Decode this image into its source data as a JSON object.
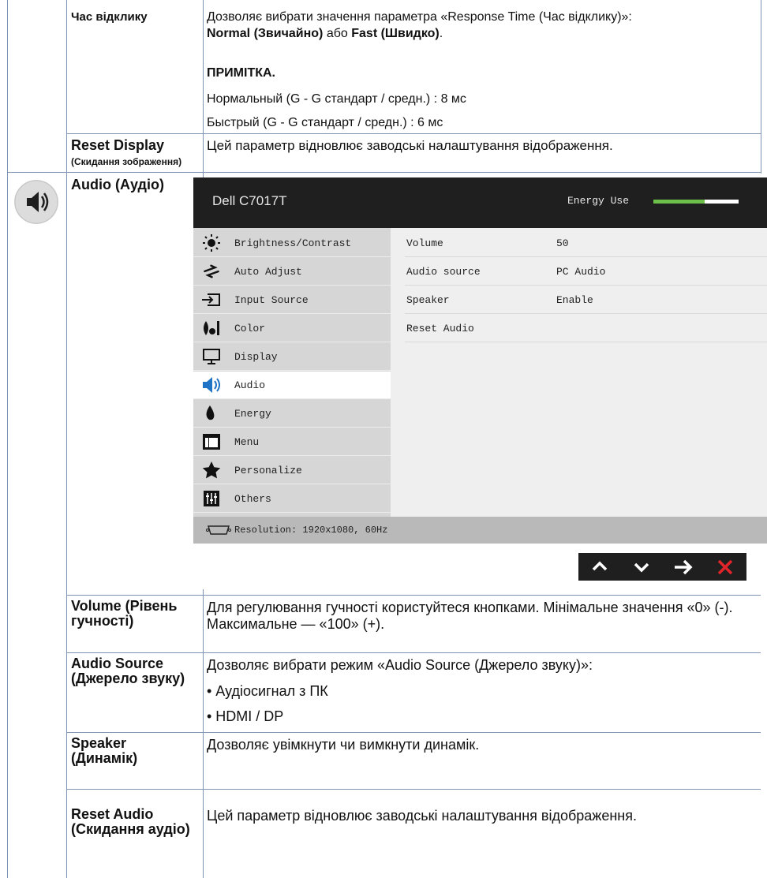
{
  "rows": {
    "response_time": {
      "label": "Час відклику",
      "desc_lead": "Дозволяє вибрати значення параметра «Response Time (Час відклику)»:",
      "opt_normal": "Normal (Звичайно)",
      "opt_or": " або ",
      "opt_fast": "Fast (Швидко)",
      "opt_end": ".",
      "note_title": "ПРИМІТКА.",
      "note_normal": "Нормальный (G - G стандарт / средн.) : 8 мс",
      "note_fast": "Быстрый (G - G стандарт / средн.) : 6 мс"
    },
    "reset_display": {
      "label": "Reset Display",
      "sublabel": "(Скидання зображення)",
      "desc": "Цей параметр відновлює заводські налаштування відображення."
    },
    "audio": {
      "label": "Audio (Аудіо)"
    },
    "volume": {
      "label": "Volume (Рівень гучності)",
      "desc": "Для регулювання гучності користуйтеся кнопками. Мінімальне значення «0» (-). Максимальне — «100» (+)."
    },
    "audio_source": {
      "label": "Audio Source (Джерело звуку)",
      "desc": "Дозволяє вибрати режим «Audio Source (Джерело звуку)»:",
      "opt1": "• Аудіосигнал з ПК",
      "opt2": "• HDMI / DP"
    },
    "speaker": {
      "label": "Speaker (Динамік)",
      "desc": "Дозволяє увімкнути чи вимкнути динамік."
    },
    "reset_audio": {
      "label": "Reset Audio (Скидання аудіо)",
      "desc": "Цей параметр відновлює заводські налаштування відображення."
    }
  },
  "osd": {
    "model": "Dell C7017T",
    "energy_label": "Energy Use",
    "energy_level": 0.6,
    "menu": [
      {
        "label": "Brightness/Contrast",
        "icon": "brightness-icon"
      },
      {
        "label": "Auto Adjust",
        "icon": "auto-adjust-icon"
      },
      {
        "label": "Input Source",
        "icon": "input-source-icon"
      },
      {
        "label": "Color",
        "icon": "color-icon"
      },
      {
        "label": "Display",
        "icon": "display-icon"
      },
      {
        "label": "Audio",
        "icon": "speaker-icon",
        "selected": true
      },
      {
        "label": "Energy",
        "icon": "energy-icon"
      },
      {
        "label": "Menu",
        "icon": "menu-icon"
      },
      {
        "label": "Personalize",
        "icon": "star-icon"
      },
      {
        "label": "Others",
        "icon": "others-icon"
      }
    ],
    "settings": [
      {
        "key": "Volume",
        "value": "50"
      },
      {
        "key": "Audio source",
        "value": "PC Audio"
      },
      {
        "key": "Speaker",
        "value": "Enable"
      },
      {
        "key": "Reset Audio",
        "value": ""
      }
    ],
    "resolution": "Resolution: 1920x1080, 60Hz",
    "colors": {
      "energy_green": "#6cc04a",
      "close_red": "#e2242b"
    }
  }
}
